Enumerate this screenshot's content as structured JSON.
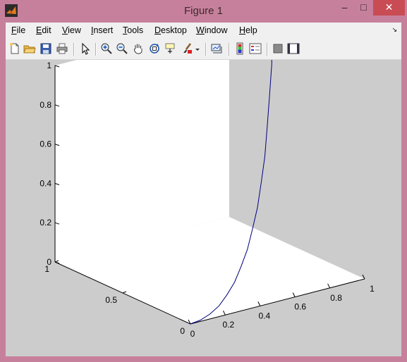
{
  "window": {
    "title": "Figure 1",
    "controls": {
      "minimize": "–",
      "maximize": "□",
      "close": "✕"
    }
  },
  "menubar": {
    "items": [
      {
        "label": "File",
        "accel": "F",
        "rest": "ile"
      },
      {
        "label": "Edit",
        "accel": "E",
        "rest": "dit"
      },
      {
        "label": "View",
        "accel": "V",
        "rest": "iew"
      },
      {
        "label": "Insert",
        "accel": "I",
        "rest": "nsert"
      },
      {
        "label": "Tools",
        "accel": "T",
        "rest": "ools"
      },
      {
        "label": "Desktop",
        "accel": "D",
        "rest": "esktop"
      },
      {
        "label": "Window",
        "accel": "W",
        "rest": "indow"
      },
      {
        "label": "Help",
        "accel": "H",
        "rest": "elp"
      }
    ]
  },
  "toolbar": {
    "icons": [
      "new-figure-icon",
      "open-file-icon",
      "save-icon",
      "print-icon",
      "edit-plot-icon",
      "zoom-in-icon",
      "zoom-out-icon",
      "pan-icon",
      "rotate-3d-icon",
      "data-cursor-icon",
      "brush-icon",
      "brush-dropdown-icon",
      "link-plot-icon",
      "colorbar-icon",
      "legend-icon",
      "hide-plot-tools-icon",
      "show-plot-tools-icon"
    ]
  },
  "chart_data": {
    "type": "line",
    "projection": "3d",
    "z_ticks": [
      "0",
      "0.2",
      "0.4",
      "0.6",
      "0.8",
      "1"
    ],
    "x_ticks": [
      "0",
      "0.2",
      "0.4",
      "0.6",
      "0.8",
      "1"
    ],
    "y_ticks": [
      "0",
      "0.5",
      "1"
    ],
    "xlim": [
      0,
      1
    ],
    "ylim": [
      0,
      1
    ],
    "zlim": [
      0,
      1
    ],
    "series": [
      {
        "color": "#000080",
        "points": [
          [
            0,
            0,
            0
          ],
          [
            0.06,
            0.003,
            0.005
          ],
          [
            0.12,
            0.01,
            0.02
          ],
          [
            0.18,
            0.02,
            0.045
          ],
          [
            0.24,
            0.04,
            0.08
          ],
          [
            0.3,
            0.06,
            0.125
          ],
          [
            0.36,
            0.09,
            0.18
          ],
          [
            0.42,
            0.12,
            0.245
          ],
          [
            0.48,
            0.16,
            0.32
          ],
          [
            0.54,
            0.2,
            0.405
          ],
          [
            0.6,
            0.25,
            0.5
          ],
          [
            0.66,
            0.3,
            0.605
          ],
          [
            0.72,
            0.36,
            0.72
          ],
          [
            0.78,
            0.42,
            0.845
          ],
          [
            0.84,
            0.48,
            0.98
          ],
          [
            0.87,
            0.52,
            1.05
          ]
        ]
      }
    ]
  }
}
